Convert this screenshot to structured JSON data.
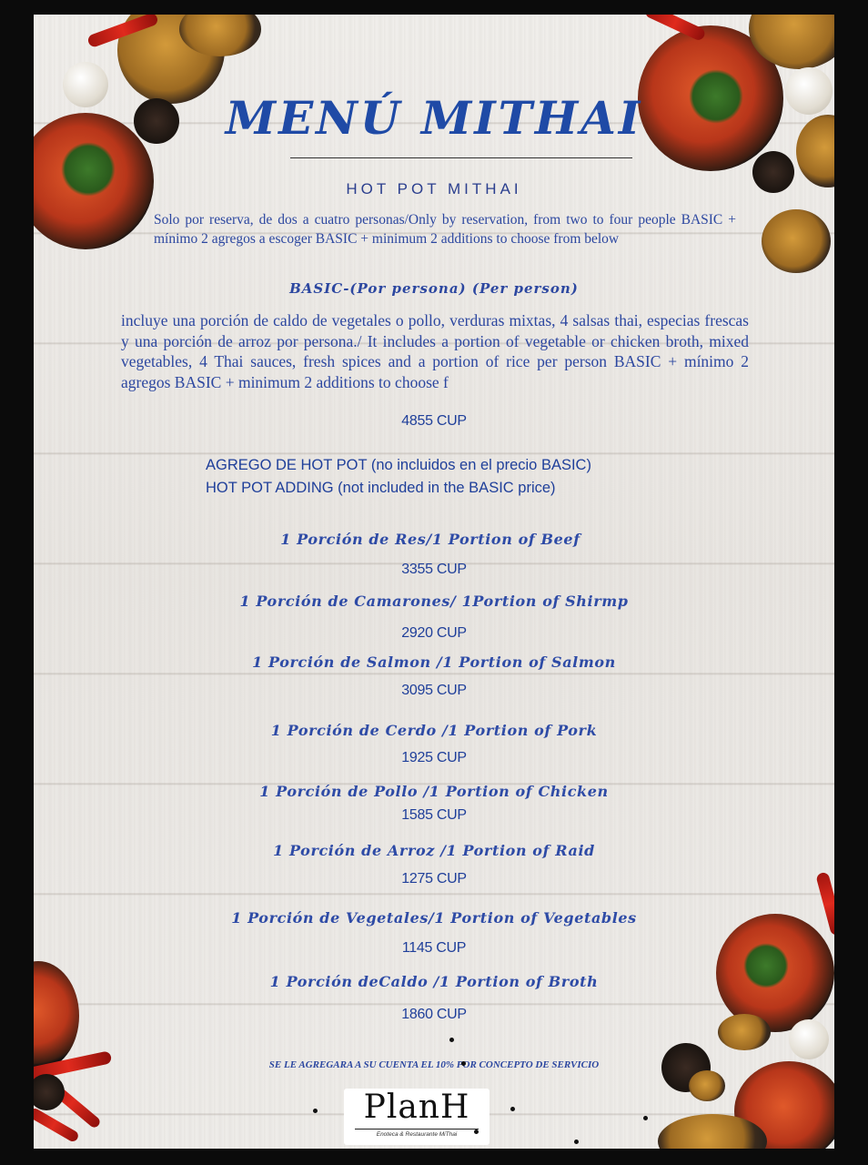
{
  "menu": {
    "title": "MENÚ MITHAI",
    "section_title": "HOT POT MITHAI",
    "intro": "Solo por reserva, de dos a cuatro personas/Only by reservation, from two to four people BASIC + mínimo 2 agregos a escoger BASIC + minimum 2 additions to choose from below",
    "basic_heading": "BASIC-(Por persona)   (Per person)",
    "basic_description": "incluye una porción de caldo de vegetales o pollo, verduras mixtas, 4 salsas thai, especias frescas y una porción de arroz por persona./ It includes a portion of vegetable or chicken broth, mixed vegetables, 4 Thai sauces, fresh spices and a portion of rice per person BASIC + mínimo 2 agregos BASIC + minimum 2 additions to choose f",
    "basic_price": "4855 CUP",
    "additions_heading_es": "AGREGO DE HOT POT (no incluidos en el precio BASIC)",
    "additions_heading_en": "HOT POT ADDING (not included in the BASIC price)",
    "items": [
      {
        "name": "1 Porción de Res/1 Portion of Beef",
        "price": "3355 CUP"
      },
      {
        "name": "1 Porción de Camarones/ 1Portion of Shirmp",
        "price": "2920  CUP"
      },
      {
        "name": "1 Porción de Salmon /1 Portion of Salmon",
        "price": "3095 CUP"
      },
      {
        "name": "1 Porción de Cerdo /1 Portion of Pork",
        "price": "1925 CUP"
      },
      {
        "name": "1 Porción de Pollo /1 Portion of Chicken",
        "price": "1585 CUP"
      },
      {
        "name": "1 Porción de Arroz  /1 Portion of Raid",
        "price": "1275 CUP"
      },
      {
        "name": "1 Porción de Vegetales/1 Portion of Vegetables",
        "price": "1145 CUP"
      },
      {
        "name": "1 Porción deCaldo /1 Portion of Broth",
        "price": "1860 CUP"
      }
    ],
    "service_note": "SE LE AGREGARA A SU CUENTA EL 10% POR CONCEPTO DE SERVICIO",
    "logo_word": "PlanH",
    "logo_tagline": "Enoteca & Restaurante MiThai"
  },
  "colors": {
    "accent_blue": "#1f4aa6",
    "paper": "#efedea",
    "frame": "#0b0b0b"
  }
}
